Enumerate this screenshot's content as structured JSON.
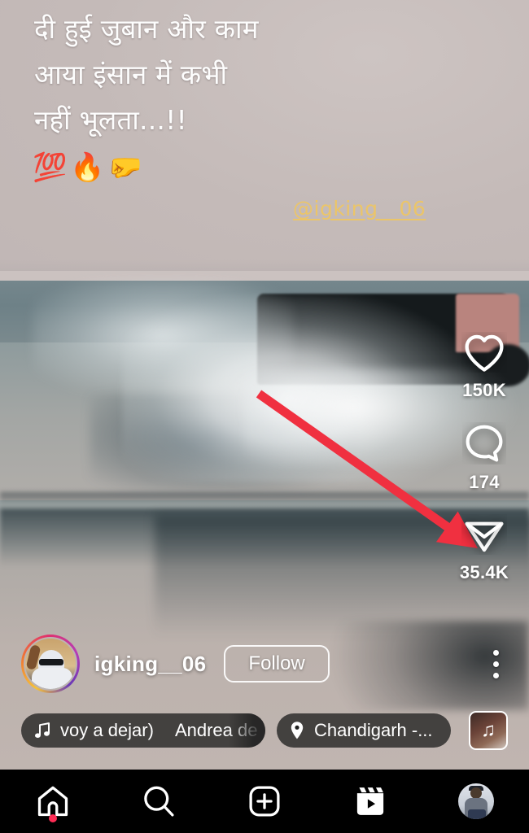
{
  "reel": {
    "caption": {
      "line1": "दी हुई जुबान और काम",
      "line2": "आया इंसान में कभी",
      "line3": "नहीं भूलता...!!",
      "emojis": "💯🔥🤛",
      "watermark": "@igking__06"
    },
    "actions": [
      {
        "name": "like",
        "icon": "heart-icon",
        "count": "150K"
      },
      {
        "name": "comment",
        "icon": "comment-icon",
        "count": "174"
      },
      {
        "name": "share",
        "icon": "share-paper-plane-icon",
        "count": "35.4K"
      }
    ],
    "meta": {
      "username": "igking__06",
      "follow_label": "Follow",
      "more_options": "more-options-icon"
    },
    "audio": {
      "icon": "music-note-icon",
      "title": "voy a dejar)",
      "artist": "Andrea de",
      "thumbnail": "audio-cover-thumbnail"
    },
    "location": {
      "icon": "location-pin-icon",
      "label": "Chandigarh -..."
    },
    "annotation": {
      "type": "arrow",
      "color": "#f03040",
      "points_to": "share-button"
    }
  },
  "bottom_nav": {
    "items": [
      {
        "name": "home",
        "icon": "home-icon",
        "badge": true
      },
      {
        "name": "search",
        "icon": "search-icon",
        "badge": false
      },
      {
        "name": "create",
        "icon": "plus-square-icon",
        "badge": false
      },
      {
        "name": "reels",
        "icon": "reels-icon",
        "badge": false
      },
      {
        "name": "profile",
        "icon": "profile-avatar-icon",
        "badge": false
      }
    ]
  },
  "colors": {
    "caption_bg": "#c4bab8",
    "watermark": "#f2c75c",
    "annotation_red": "#f03040",
    "badge_red": "#fe2c55",
    "nav_bg": "#000000"
  }
}
